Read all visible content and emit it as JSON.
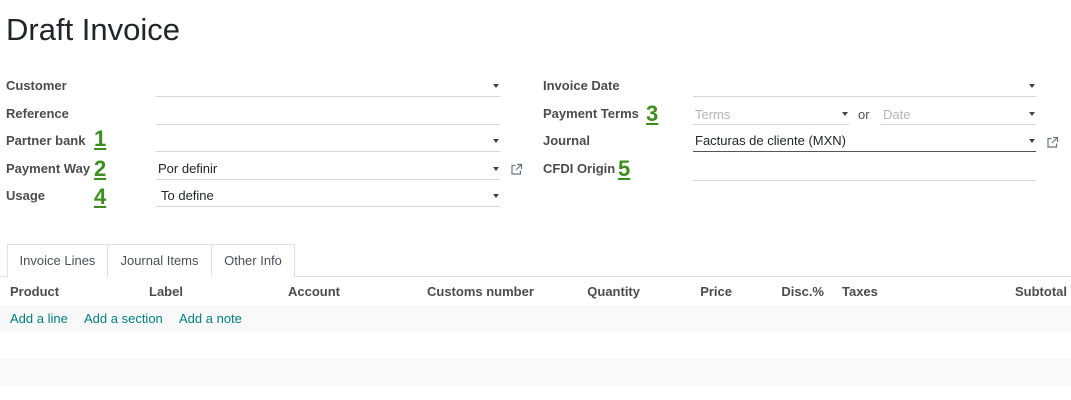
{
  "title": "Draft Invoice",
  "left_fields": {
    "customer": {
      "label": "Customer",
      "value": ""
    },
    "reference": {
      "label": "Reference",
      "value": ""
    },
    "partner_bank": {
      "label": "Partner bank",
      "value": "",
      "annotation": "1"
    },
    "payment_way": {
      "label": "Payment Way",
      "value": "Por definir",
      "annotation": "2"
    },
    "usage": {
      "label": "Usage",
      "value": "To define",
      "annotation": "4"
    }
  },
  "right_fields": {
    "invoice_date": {
      "label": "Invoice Date",
      "value": ""
    },
    "payment_terms": {
      "label": "Payment Terms",
      "annotation": "3",
      "terms_placeholder": "Terms",
      "or_text": "or",
      "date_placeholder": "Date"
    },
    "journal": {
      "label": "Journal",
      "value": "Facturas de cliente (MXN)"
    },
    "cfdi_origin": {
      "label": "CFDI Origin",
      "value": "",
      "annotation": "5"
    }
  },
  "tabs": [
    {
      "label": "Invoice Lines",
      "active": true
    },
    {
      "label": "Journal Items",
      "active": false
    },
    {
      "label": "Other Info",
      "active": false
    }
  ],
  "columns": [
    "Product",
    "Label",
    "Account",
    "Customs number",
    "Quantity",
    "Price",
    "Disc.%",
    "Taxes",
    "Subtotal"
  ],
  "actions": {
    "add_line": "Add a line",
    "add_section": "Add a section",
    "add_note": "Add a note"
  },
  "colors": {
    "annotation": "#3e8e1f",
    "link": "#017e84"
  },
  "icons": [
    "dropdown-caret-icon",
    "external-link-icon"
  ]
}
